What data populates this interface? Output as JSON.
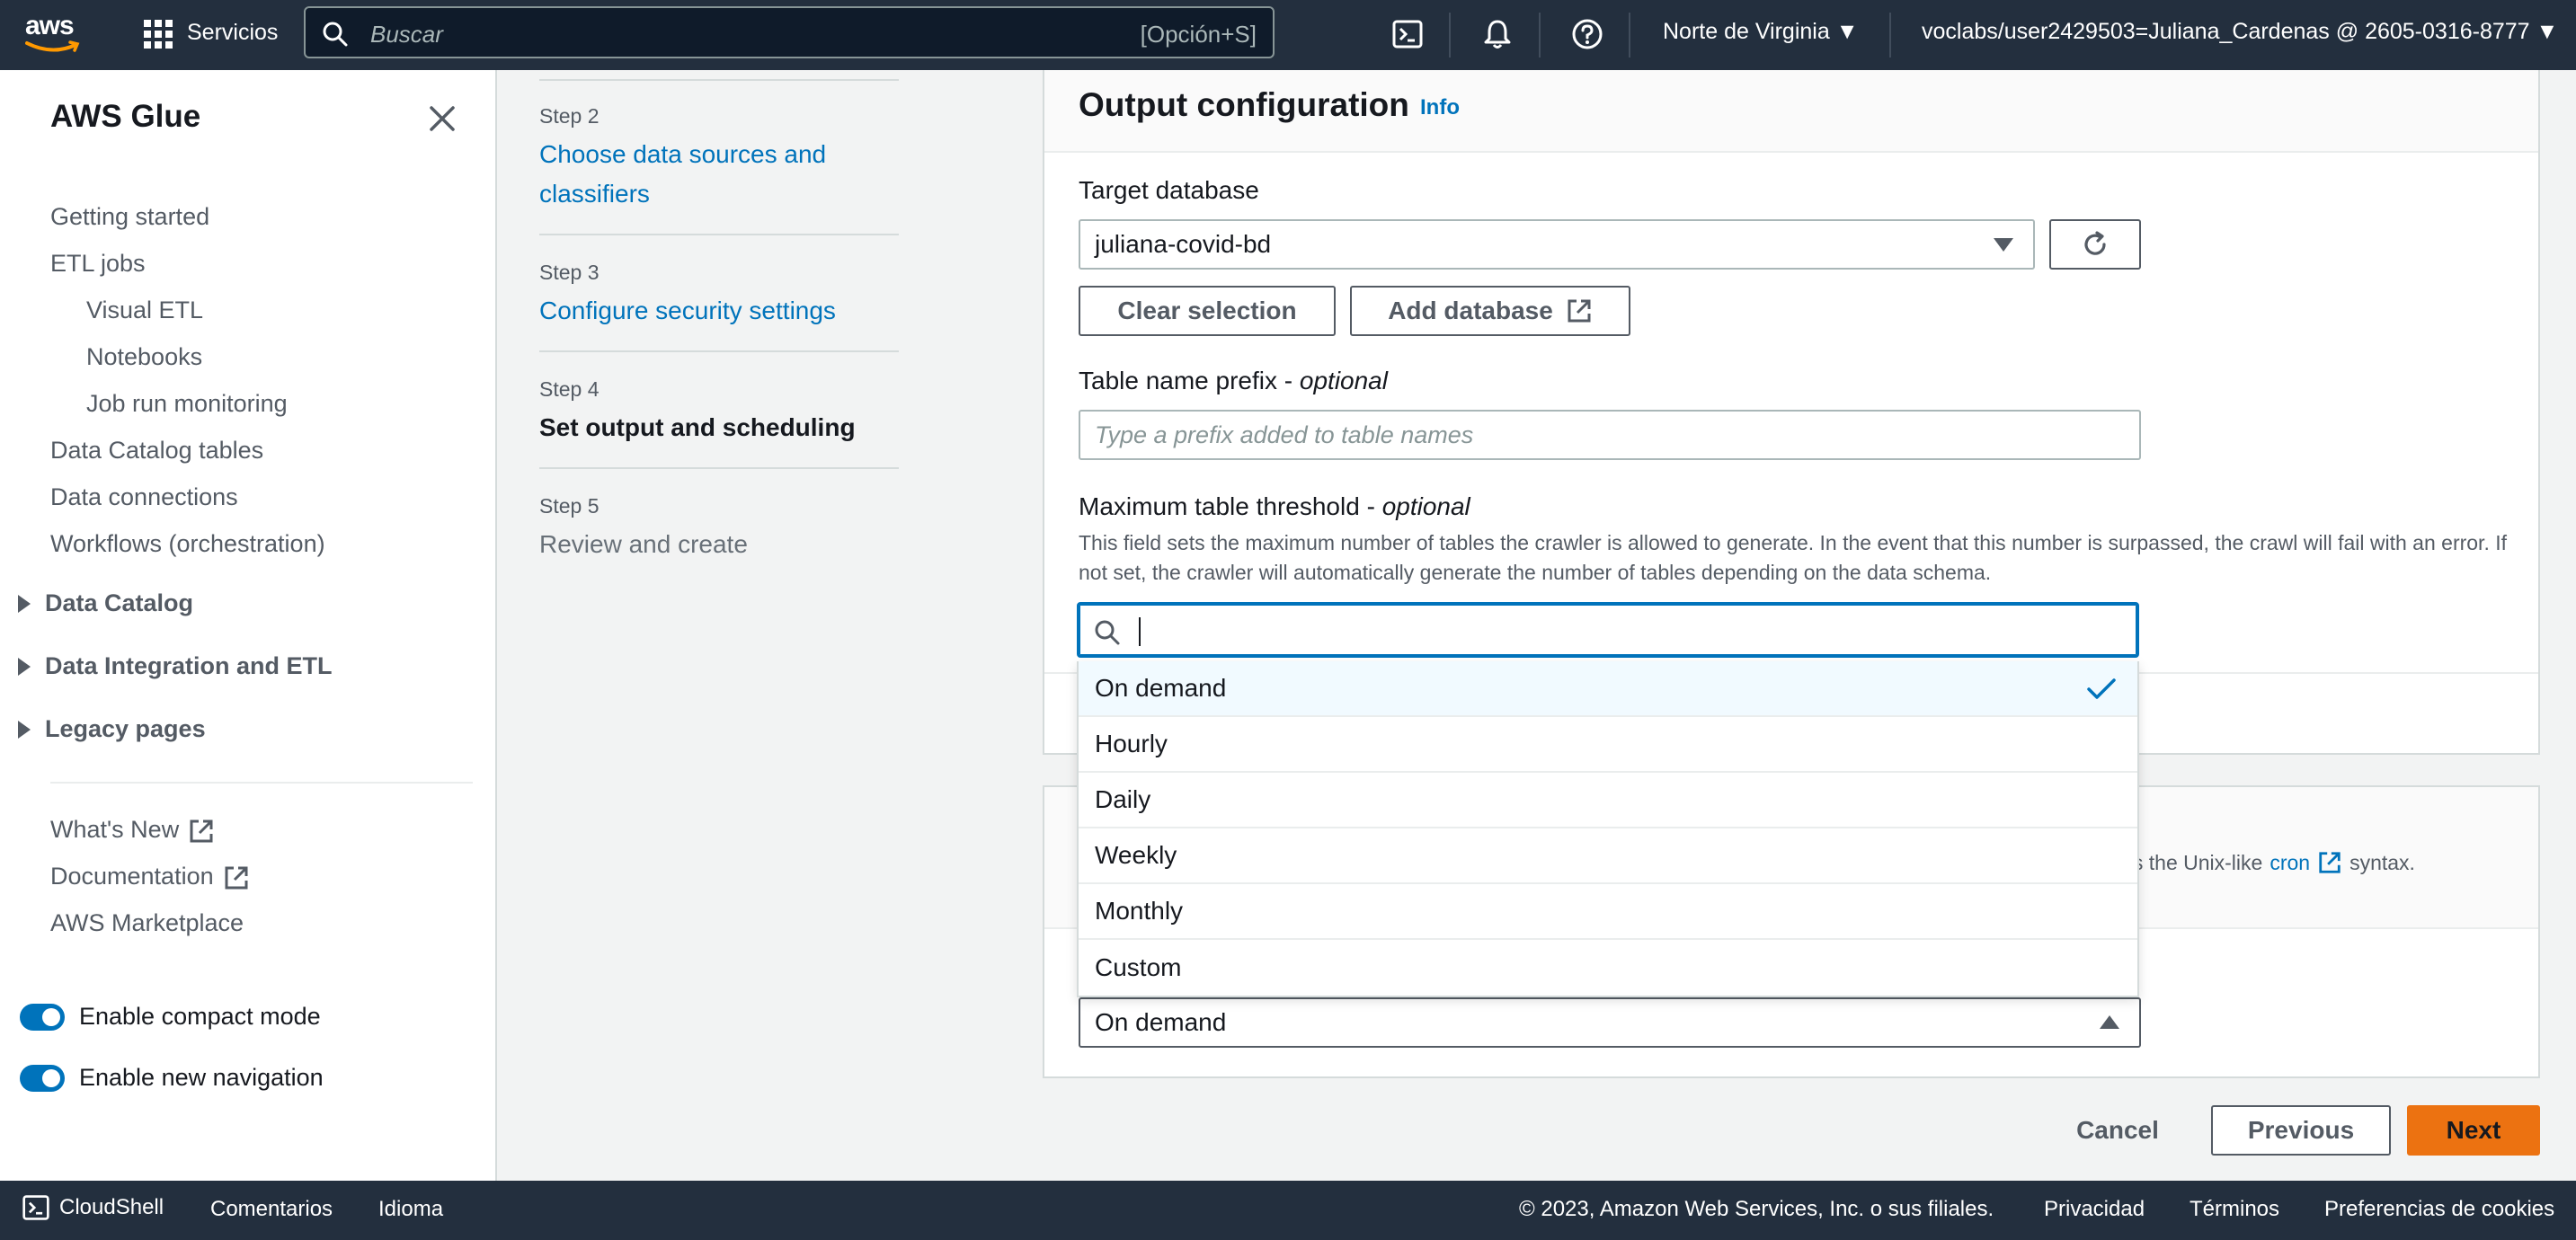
{
  "topnav": {
    "logo_text": "aws",
    "services_label": "Servicios",
    "search_placeholder": "Buscar",
    "search_shortcut": "[Opción+S]",
    "region": "Norte de Virginia",
    "account": "voclabs/user2429503=Juliana_Cardenas @ 2605-0316-8777"
  },
  "sidebar": {
    "title": "AWS Glue",
    "links": [
      "Getting started",
      "ETL jobs",
      "Visual ETL",
      "Notebooks",
      "Job run monitoring",
      "Data Catalog tables",
      "Data connections",
      "Workflows (orchestration)"
    ],
    "sections": [
      "Data Catalog",
      "Data Integration and ETL",
      "Legacy pages"
    ],
    "footer_links": [
      "What's New",
      "Documentation",
      "AWS Marketplace"
    ],
    "toggles": [
      "Enable compact mode",
      "Enable new navigation"
    ]
  },
  "steps": [
    {
      "num": "Step 2",
      "title": "Choose data sources and classifiers"
    },
    {
      "num": "Step 3",
      "title": "Configure security settings"
    },
    {
      "num": "Step 4",
      "title": "Set output and scheduling"
    },
    {
      "num": "Step 5",
      "title": "Review and create"
    }
  ],
  "output": {
    "heading": "Output configuration",
    "info": "Info",
    "target_db_label": "Target database",
    "target_db_value": "juliana-covid-bd",
    "clear_selection": "Clear selection",
    "add_database": "Add database",
    "prefix_label": "Table name prefix - ",
    "prefix_optional": "optional",
    "prefix_placeholder": "Type a prefix added to table names",
    "threshold_label": "Maximum table threshold - ",
    "threshold_optional": "optional",
    "threshold_desc": "This field sets the maximum number of tables the crawler is allowed to generate. In the event that this number is surpassed, the crawl will fail with an error. If not set, the crawler will automatically generate the number of tables depending on the data schema."
  },
  "schedule": {
    "desc_tail": "les uses the Unix-like",
    "cron_link": "cron",
    "desc_end": "syntax.",
    "frequency_value": "On demand",
    "options": [
      "On demand",
      "Hourly",
      "Daily",
      "Weekly",
      "Monthly",
      "Custom"
    ],
    "selected": "On demand"
  },
  "actions": {
    "cancel": "Cancel",
    "previous": "Previous",
    "next": "Next"
  },
  "footer": {
    "cloudshell": "CloudShell",
    "feedback": "Comentarios",
    "language": "Idioma",
    "copyright": "© 2023, Amazon Web Services, Inc. o sus filiales.",
    "privacy": "Privacidad",
    "terms": "Términos",
    "cookies": "Preferencias de cookies"
  },
  "colors": {
    "nav_bg": "#232f3e",
    "link": "#0073bb",
    "primary": "#ec7211"
  }
}
